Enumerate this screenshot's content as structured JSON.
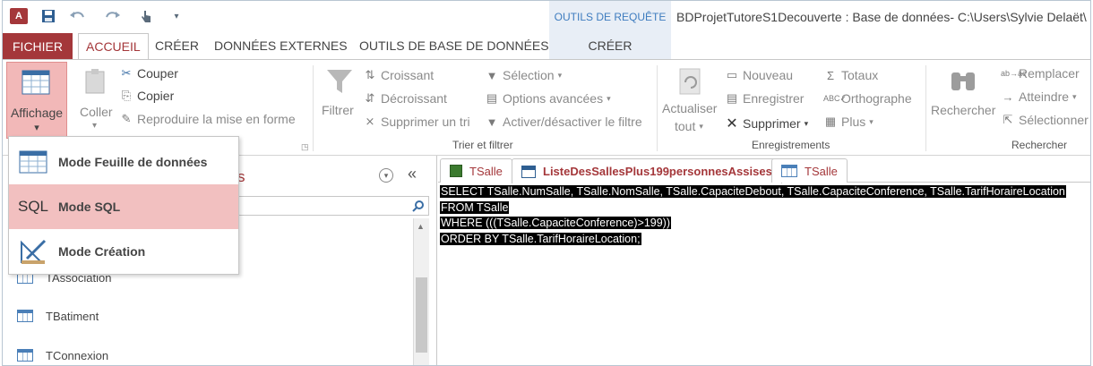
{
  "titlebar": {
    "app_logo": "A",
    "context_group": "OUTILS DE REQUÊTE",
    "window_title": "BDProjetTutoreS1Decouverte : Base de données- C:\\Users\\Sylvie Delaët\\"
  },
  "tabs": {
    "file": "FICHIER",
    "items": [
      "ACCUEIL",
      "CRÉER",
      "DONNÉES EXTERNES",
      "OUTILS DE BASE DE DONNÉES",
      "CRÉER"
    ]
  },
  "ribbon": {
    "view": {
      "label": "Affichage",
      "arrow": "▾"
    },
    "clipboard": {
      "paste": "Coller",
      "cut": "Couper",
      "copy": "Copier",
      "format_painter": "Reproduire la mise en forme"
    },
    "sort_filter": {
      "filter": "Filtrer",
      "ascending": "Croissant",
      "descending": "Décroissant",
      "remove_sort": "Supprimer un tri",
      "selection": "Sélection",
      "advanced": "Options avancées",
      "toggle_filter": "Activer/désactiver le filtre",
      "group_label": "Trier et filtrer"
    },
    "records": {
      "refresh": "Actualiser",
      "refresh_sub": "tout",
      "new": "Nouveau",
      "save": "Enregistrer",
      "delete": "Supprimer",
      "totals": "Totaux",
      "spelling": "Orthographe",
      "more": "Plus",
      "group_label": "Enregistrements"
    },
    "find": {
      "find": "Rechercher",
      "replace": "Remplacer",
      "goto": "Atteindre",
      "select": "Sélectionner",
      "group_label": "Rechercher"
    }
  },
  "view_menu": {
    "items": [
      {
        "label": "Mode Feuille de données",
        "icon": "datasheet-icon"
      },
      {
        "label": "Mode SQL",
        "icon": "sql-icon",
        "icon_text": "SQL",
        "selected": true
      },
      {
        "label": "Mode Création",
        "icon": "design-icon"
      }
    ]
  },
  "nav": {
    "title_fragment": "s",
    "items": [
      "TAssociation",
      "TBatiment",
      "TConnexion"
    ]
  },
  "doc_tabs": [
    {
      "label": "TSalle",
      "icon": "table-icon"
    },
    {
      "label": "ListeDesSallesPlus199personnesAssises",
      "icon": "query-icon",
      "active": true
    },
    {
      "label": "TSalle",
      "icon": "table-icon"
    }
  ],
  "sql": {
    "lines": [
      "SELECT TSalle.NumSalle, TSalle.NomSalle, TSalle.CapaciteDebout, TSalle.CapaciteConference, TSalle.TarifHoraireLocation",
      "FROM TSalle",
      "WHERE (((TSalle.CapaciteConference)>199))",
      "ORDER BY TSalle.TarifHoraireLocation;"
    ]
  },
  "colors": {
    "accent": "#a4373a",
    "context": "#e8eef6",
    "selection": "#f2c0c0"
  }
}
